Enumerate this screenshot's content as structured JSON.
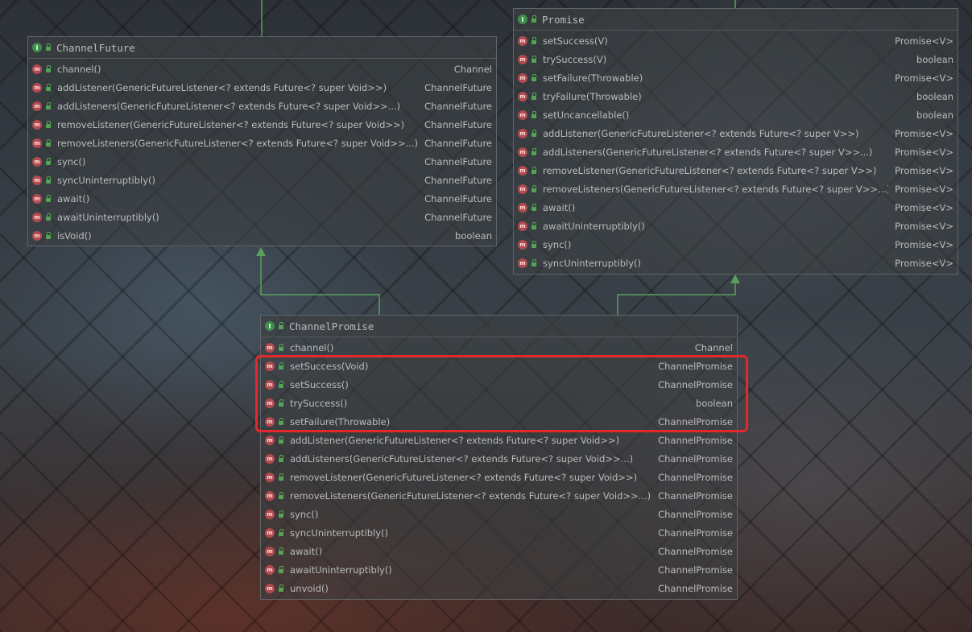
{
  "diagram": {
    "nodes": [
      {
        "id": "channel-future",
        "icon": "interface-icon",
        "icon_letter": "I",
        "title": "ChannelFuture",
        "methods": [
          {
            "sig": "channel()",
            "ret": "Channel"
          },
          {
            "sig": "addListener(GenericFutureListener<? extends Future<? super Void>>)",
            "ret": "ChannelFuture"
          },
          {
            "sig": "addListeners(GenericFutureListener<? extends Future<? super Void>>...)",
            "ret": "ChannelFuture"
          },
          {
            "sig": "removeListener(GenericFutureListener<? extends Future<? super Void>>)",
            "ret": "ChannelFuture"
          },
          {
            "sig": "removeListeners(GenericFutureListener<? extends Future<? super Void>>...)",
            "ret": "ChannelFuture"
          },
          {
            "sig": "sync()",
            "ret": "ChannelFuture"
          },
          {
            "sig": "syncUninterruptibly()",
            "ret": "ChannelFuture"
          },
          {
            "sig": "await()",
            "ret": "ChannelFuture"
          },
          {
            "sig": "awaitUninterruptibly()",
            "ret": "ChannelFuture"
          },
          {
            "sig": "isVoid()",
            "ret": "boolean"
          }
        ]
      },
      {
        "id": "promise",
        "icon": "interface-icon",
        "icon_letter": "I",
        "title": "Promise",
        "methods": [
          {
            "sig": "setSuccess(V)",
            "ret": "Promise<V>"
          },
          {
            "sig": "trySuccess(V)",
            "ret": "boolean"
          },
          {
            "sig": "setFailure(Throwable)",
            "ret": "Promise<V>"
          },
          {
            "sig": "tryFailure(Throwable)",
            "ret": "boolean"
          },
          {
            "sig": "setUncancellable()",
            "ret": "boolean"
          },
          {
            "sig": "addListener(GenericFutureListener<? extends Future<? super V>>)",
            "ret": "Promise<V>"
          },
          {
            "sig": "addListeners(GenericFutureListener<? extends Future<? super V>>...)",
            "ret": "Promise<V>"
          },
          {
            "sig": "removeListener(GenericFutureListener<? extends Future<? super V>>)",
            "ret": "Promise<V>"
          },
          {
            "sig": "removeListeners(GenericFutureListener<? extends Future<? super V>>...)",
            "ret": "Promise<V>"
          },
          {
            "sig": "await()",
            "ret": "Promise<V>"
          },
          {
            "sig": "awaitUninterruptibly()",
            "ret": "Promise<V>"
          },
          {
            "sig": "sync()",
            "ret": "Promise<V>"
          },
          {
            "sig": "syncUninterruptibly()",
            "ret": "Promise<V>"
          }
        ]
      },
      {
        "id": "channel-promise",
        "icon": "interface-icon",
        "icon_letter": "I",
        "title": "ChannelPromise",
        "methods": [
          {
            "sig": "channel()",
            "ret": "Channel"
          },
          {
            "sig": "setSuccess(Void)",
            "ret": "ChannelPromise"
          },
          {
            "sig": "setSuccess()",
            "ret": "ChannelPromise"
          },
          {
            "sig": "trySuccess()",
            "ret": "boolean"
          },
          {
            "sig": "setFailure(Throwable)",
            "ret": "ChannelPromise"
          },
          {
            "sig": "addListener(GenericFutureListener<? extends Future<? super Void>>)",
            "ret": "ChannelPromise"
          },
          {
            "sig": "addListeners(GenericFutureListener<? extends Future<? super Void>>...)",
            "ret": "ChannelPromise"
          },
          {
            "sig": "removeListener(GenericFutureListener<? extends Future<? super Void>>)",
            "ret": "ChannelPromise"
          },
          {
            "sig": "removeListeners(GenericFutureListener<? extends Future<? super Void>>...)",
            "ret": "ChannelPromise"
          },
          {
            "sig": "sync()",
            "ret": "ChannelPromise"
          },
          {
            "sig": "syncUninterruptibly()",
            "ret": "ChannelPromise"
          },
          {
            "sig": "await()",
            "ret": "ChannelPromise"
          },
          {
            "sig": "awaitUninterruptibly()",
            "ret": "ChannelPromise"
          },
          {
            "sig": "unvoid()",
            "ret": "ChannelPromise"
          }
        ]
      }
    ],
    "edges": [
      {
        "from": "channel-promise",
        "to": "channel-future",
        "type": "extends"
      },
      {
        "from": "channel-promise",
        "to": "promise",
        "type": "extends"
      }
    ],
    "method_icon": "method-icon",
    "method_icon_letter": "m",
    "visibility_icon": "public-lock-icon",
    "highlight": {
      "node": "channel-promise",
      "rows": [
        1,
        4
      ],
      "color": "#e3292b"
    },
    "colors": {
      "edge": "#5aa05c",
      "interface_icon": "#3d8f4b",
      "method_icon": "#b14b4f"
    }
  }
}
